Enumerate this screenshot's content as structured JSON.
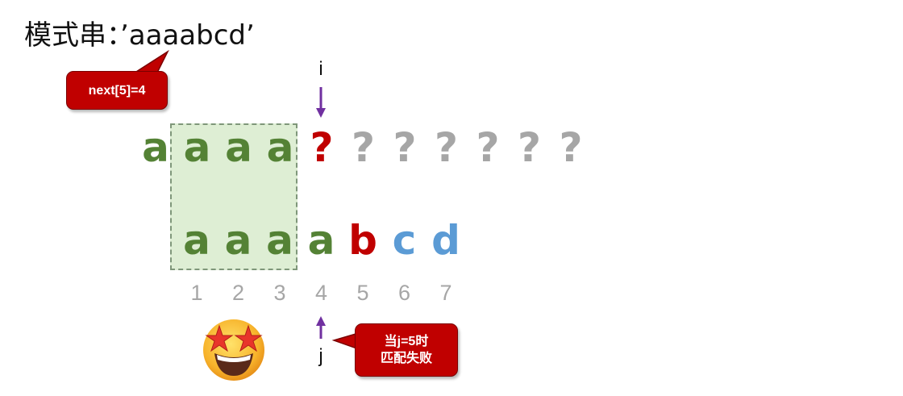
{
  "title": "模式串：’aaaabcd’",
  "callout_next": "next[5]=4",
  "callout_fail": [
    "当j=5时",
    "匹配失败"
  ],
  "pointer_i": "i",
  "pointer_j": "j",
  "text_row": [
    {
      "ch": "a",
      "color": "#548235"
    },
    {
      "ch": "a",
      "color": "#548235"
    },
    {
      "ch": "a",
      "color": "#548235"
    },
    {
      "ch": "a",
      "color": "#548235"
    },
    {
      "ch": "?",
      "color": "#c00000"
    },
    {
      "ch": "?",
      "color": "#a6a6a6"
    },
    {
      "ch": "?",
      "color": "#a6a6a6"
    },
    {
      "ch": "?",
      "color": "#a6a6a6"
    },
    {
      "ch": "?",
      "color": "#a6a6a6"
    },
    {
      "ch": "?",
      "color": "#a6a6a6"
    },
    {
      "ch": "?",
      "color": "#a6a6a6"
    }
  ],
  "pattern_row": [
    {
      "ch": "a",
      "color": "#548235"
    },
    {
      "ch": "a",
      "color": "#548235"
    },
    {
      "ch": "a",
      "color": "#548235"
    },
    {
      "ch": "a",
      "color": "#548235"
    },
    {
      "ch": "b",
      "color": "#c00000"
    },
    {
      "ch": "c",
      "color": "#5b9bd5"
    },
    {
      "ch": "d",
      "color": "#5b9bd5"
    }
  ],
  "indices": [
    "1",
    "2",
    "3",
    "4",
    "5",
    "6",
    "7"
  ],
  "emoji": "star-struck-emoji",
  "colors": {
    "arrow": "#7030a0",
    "highlight": "#deeed4",
    "callout": "#c00000"
  }
}
